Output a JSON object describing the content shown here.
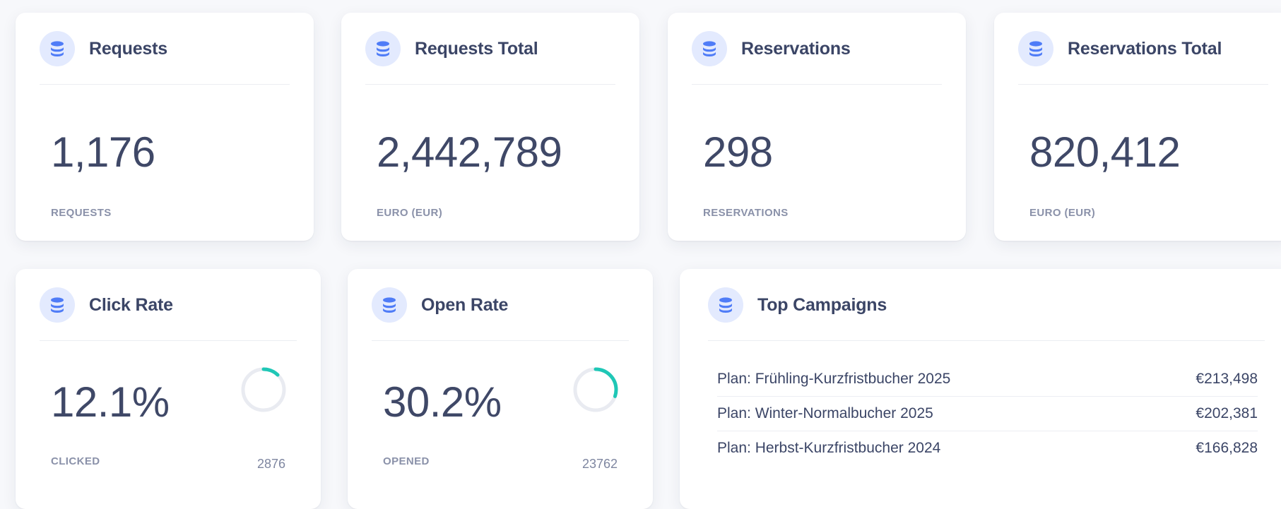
{
  "colors": {
    "accent": "#4f7cf7",
    "icon_bg": "#e3eafe",
    "ring_progress": "#1fc7b6",
    "ring_track": "#e9ebf1"
  },
  "cards": {
    "requests": {
      "title": "Requests",
      "value": "1,176",
      "sub": "REQUESTS",
      "icon": "database-icon"
    },
    "requests_total": {
      "title": "Requests Total",
      "value": "2,442,789",
      "sub": "EURO (EUR)",
      "icon": "database-icon"
    },
    "reservations": {
      "title": "Reservations",
      "value": "298",
      "sub": "RESERVATIONS",
      "icon": "database-icon"
    },
    "reservations_total": {
      "title": "Reservations Total",
      "value": "820,412",
      "sub": "EURO (EUR)",
      "icon": "database-icon"
    },
    "click_rate": {
      "title": "Click Rate",
      "value": "12.1%",
      "sub": "CLICKED",
      "count": "2876",
      "progress": 0.121,
      "icon": "database-icon"
    },
    "open_rate": {
      "title": "Open Rate",
      "value": "30.2%",
      "sub": "OPENED",
      "count": "23762",
      "progress": 0.302,
      "icon": "database-icon"
    },
    "top_campaigns": {
      "title": "Top Campaigns",
      "icon": "database-icon",
      "rows": [
        {
          "name": "Plan: Frühling-Kurzfristbucher 2025",
          "amount": "€213,498"
        },
        {
          "name": "Plan: Winter-Normalbucher 2025",
          "amount": "€202,381"
        },
        {
          "name": "Plan: Herbst-Kurzfristbucher 2024",
          "amount": "€166,828"
        }
      ]
    }
  }
}
